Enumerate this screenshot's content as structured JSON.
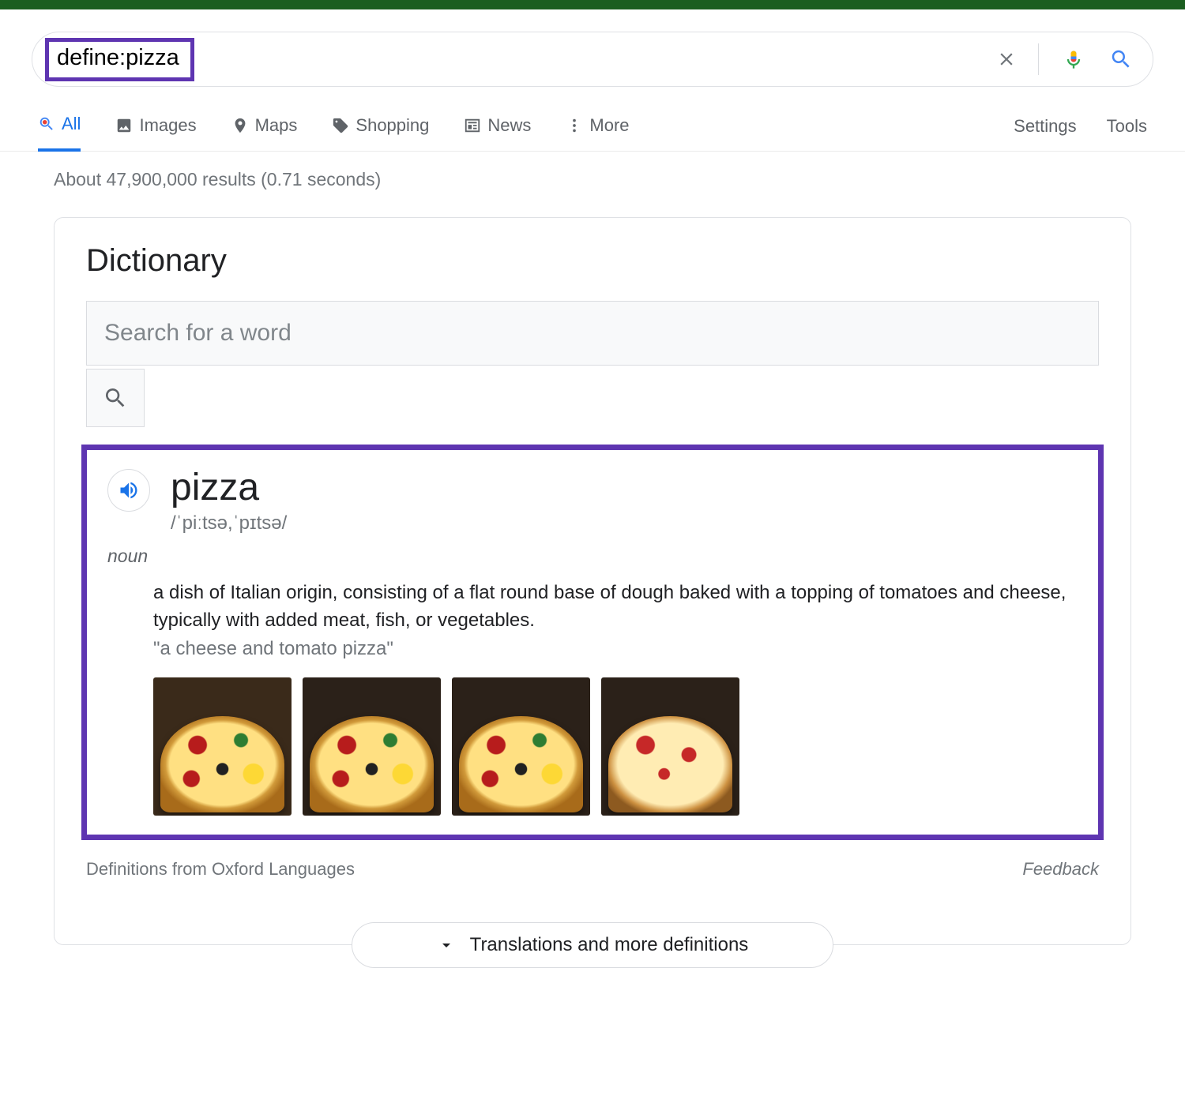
{
  "search": {
    "query": "define:pizza"
  },
  "tabs": {
    "all": "All",
    "images": "Images",
    "maps": "Maps",
    "shopping": "Shopping",
    "news": "News",
    "more": "More",
    "settings": "Settings",
    "tools": "Tools"
  },
  "result_stats": "About 47,900,000 results (0.71 seconds)",
  "dictionary": {
    "title": "Dictionary",
    "search_placeholder": "Search for a word",
    "word": "pizza",
    "phonetic": "/ˈpiːtsə,ˈpɪtsə/",
    "part_of_speech": "noun",
    "definition": "a dish of Italian origin, consisting of a flat round base of dough baked with a topping of tomatoes and cheese, typically with added meat, fish, or vegetables.",
    "example": "\"a cheese and tomato pizza\"",
    "source": "Definitions from Oxford Languages",
    "feedback": "Feedback",
    "expand": "Translations and more definitions"
  }
}
